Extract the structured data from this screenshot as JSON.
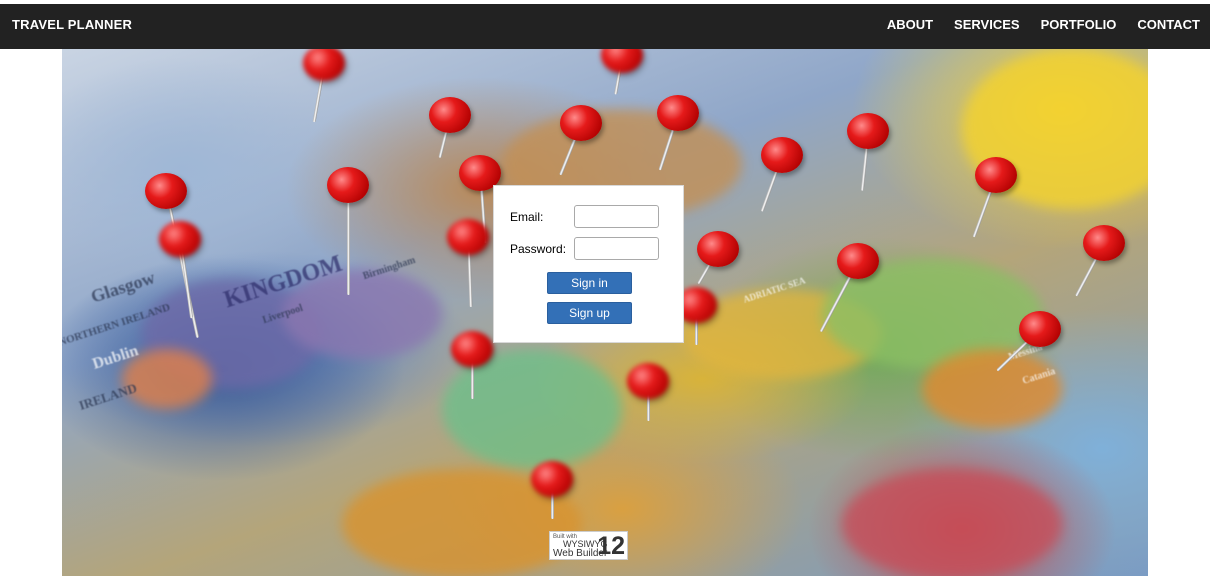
{
  "navbar": {
    "brand": "TRAVEL PLANNER",
    "links": [
      "ABOUT",
      "SERVICES",
      "PORTFOLIO",
      "CONTACT"
    ],
    "background": "#222222"
  },
  "login": {
    "email_label": "Email:",
    "email_value": "",
    "password_label": "Password:",
    "password_value": "",
    "signin_label": "Sign in",
    "signup_label": "Sign up",
    "button_color": "#3370b7"
  },
  "hero": {
    "image": "blurred world map with red push pins",
    "map_labels": [
      "Glasgow",
      "NORTHERN IRELAND",
      "Dublin",
      "IRELAND",
      "KINGDOM",
      "Birmingham",
      "Liverpool",
      "ADRIATIC SEA",
      "Messina",
      "Catania"
    ]
  },
  "badge": {
    "line1": "Built with",
    "line2": "WYSIWYG",
    "line3": "Web Builder",
    "number": "12"
  }
}
